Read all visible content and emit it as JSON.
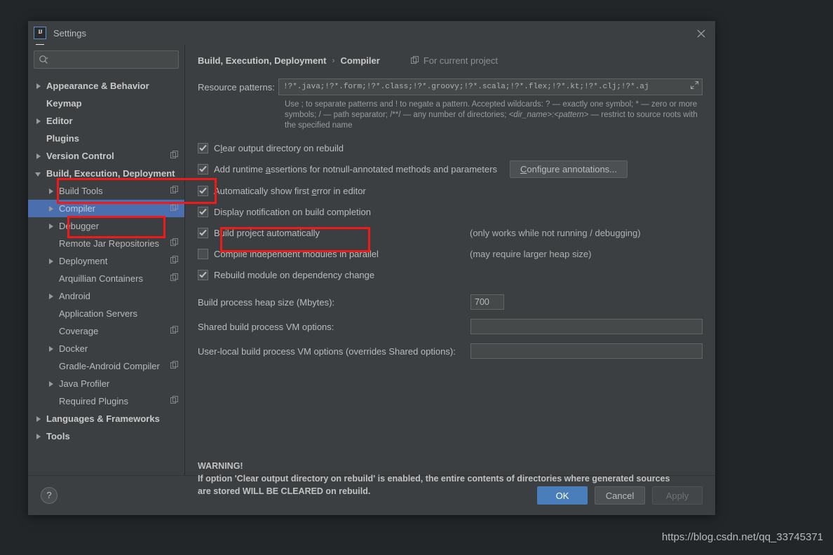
{
  "window": {
    "title": "Settings",
    "app_icon": "intellij-idea-icon",
    "close_icon": "close-icon"
  },
  "sidebar": {
    "search": {
      "value": "",
      "placeholder": ""
    },
    "items": [
      {
        "label": "Appearance & Behavior",
        "arrow": "right",
        "bold": true,
        "indent": 0,
        "module_icon": false,
        "selected": false
      },
      {
        "label": "Keymap",
        "arrow": "none",
        "bold": true,
        "indent": 0,
        "module_icon": false,
        "selected": false
      },
      {
        "label": "Editor",
        "arrow": "right",
        "bold": true,
        "indent": 0,
        "module_icon": false,
        "selected": false
      },
      {
        "label": "Plugins",
        "arrow": "none",
        "bold": true,
        "indent": 0,
        "module_icon": false,
        "selected": false
      },
      {
        "label": "Version Control",
        "arrow": "right",
        "bold": true,
        "indent": 0,
        "module_icon": true,
        "selected": false
      },
      {
        "label": "Build, Execution, Deployment",
        "arrow": "down",
        "bold": true,
        "indent": 0,
        "module_icon": false,
        "selected": false
      },
      {
        "label": "Build Tools",
        "arrow": "right",
        "bold": false,
        "indent": 1,
        "module_icon": true,
        "selected": false
      },
      {
        "label": "Compiler",
        "arrow": "right",
        "bold": false,
        "indent": 1,
        "module_icon": true,
        "selected": true
      },
      {
        "label": "Debugger",
        "arrow": "right",
        "bold": false,
        "indent": 1,
        "module_icon": false,
        "selected": false
      },
      {
        "label": "Remote Jar Repositories",
        "arrow": "none",
        "bold": false,
        "indent": 1,
        "module_icon": true,
        "selected": false
      },
      {
        "label": "Deployment",
        "arrow": "right",
        "bold": false,
        "indent": 1,
        "module_icon": true,
        "selected": false
      },
      {
        "label": "Arquillian Containers",
        "arrow": "none",
        "bold": false,
        "indent": 1,
        "module_icon": true,
        "selected": false
      },
      {
        "label": "Android",
        "arrow": "right",
        "bold": false,
        "indent": 1,
        "module_icon": false,
        "selected": false
      },
      {
        "label": "Application Servers",
        "arrow": "none",
        "bold": false,
        "indent": 1,
        "module_icon": false,
        "selected": false
      },
      {
        "label": "Coverage",
        "arrow": "none",
        "bold": false,
        "indent": 1,
        "module_icon": true,
        "selected": false
      },
      {
        "label": "Docker",
        "arrow": "right",
        "bold": false,
        "indent": 1,
        "module_icon": false,
        "selected": false
      },
      {
        "label": "Gradle-Android Compiler",
        "arrow": "none",
        "bold": false,
        "indent": 1,
        "module_icon": true,
        "selected": false
      },
      {
        "label": "Java Profiler",
        "arrow": "right",
        "bold": false,
        "indent": 1,
        "module_icon": false,
        "selected": false
      },
      {
        "label": "Required Plugins",
        "arrow": "none",
        "bold": false,
        "indent": 1,
        "module_icon": true,
        "selected": false
      },
      {
        "label": "Languages & Frameworks",
        "arrow": "right",
        "bold": true,
        "indent": 0,
        "module_icon": false,
        "selected": false
      },
      {
        "label": "Tools",
        "arrow": "right",
        "bold": true,
        "indent": 0,
        "module_icon": false,
        "selected": false
      }
    ]
  },
  "main": {
    "breadcrumb": {
      "parent": "Build, Execution, Deployment",
      "separator": "›",
      "current": "Compiler",
      "scope_label": "For current project",
      "scope_icon": "module-scope-icon"
    },
    "resource_patterns": {
      "label": "Resource patterns:",
      "value": "!?*.java;!?*.form;!?*.class;!?*.groovy;!?*.scala;!?*.flex;!?*.kt;!?*.clj;!?*.aj",
      "expand_icon": "expand-icon",
      "help_1": "Use ; to separate patterns and ! to negate a pattern. Accepted wildcards: ? — exactly one symbol; * — zero or more symbols; / — path separator; /**/ — any number of directories;",
      "help_dir": "<dir_name>:<pattern>",
      "help_2": "— restrict to source roots with the specified name"
    },
    "checkboxes": [
      {
        "label_pre": "C",
        "label_mn": "l",
        "label_post": "ear output directory on rebuild",
        "checked": true,
        "note": ""
      },
      {
        "label_pre": "Add runtime ",
        "label_mn": "a",
        "label_post": "ssertions for notnull-annotated methods and parameters",
        "checked": true,
        "note": ""
      },
      {
        "label_pre": "Automatically show first ",
        "label_mn": "e",
        "label_post": "rror in editor",
        "checked": true,
        "note": ""
      },
      {
        "label_pre": "Display notification on build completion",
        "label_mn": "",
        "label_post": "",
        "checked": true,
        "note": ""
      },
      {
        "label_pre": "Build project automatically",
        "label_mn": "",
        "label_post": "",
        "checked": true,
        "note": "(only works while not running / debugging)"
      },
      {
        "label_pre": "Compile independent modules in parallel",
        "label_mn": "",
        "label_post": "",
        "checked": false,
        "note": "(may require larger heap size)"
      },
      {
        "label_pre": "Rebuild module on dependency change",
        "label_mn": "",
        "label_post": "",
        "checked": true,
        "note": ""
      }
    ],
    "configure_button": {
      "pre": "C",
      "mn": "C",
      "post": "onfigure annotations..."
    },
    "fields": {
      "heap_label": "Build process heap size (Mbytes):",
      "heap_value": "700",
      "shared_label": "Shared build process VM options:",
      "shared_value": "",
      "userlocal_label": "User-local build process VM options (overrides Shared options):",
      "userlocal_value": ""
    },
    "warning": {
      "title": "WARNING!",
      "line1": "If option 'Clear output directory on rebuild' is enabled, the entire contents of directories where generated sources",
      "line2": "are stored WILL BE CLEARED on rebuild."
    }
  },
  "footer": {
    "help_label": "?",
    "ok_label": "OK",
    "cancel_label": "Cancel",
    "apply_label": "Apply"
  },
  "watermark": "https://blog.csdn.net/qq_33745371",
  "colors": {
    "accent_blue": "#4a7ebb",
    "selection_blue": "#4b6eaf",
    "panel_bg": "#3c3f41",
    "desktop_bg": "#232629",
    "annotation_red": "#f01a1a"
  }
}
